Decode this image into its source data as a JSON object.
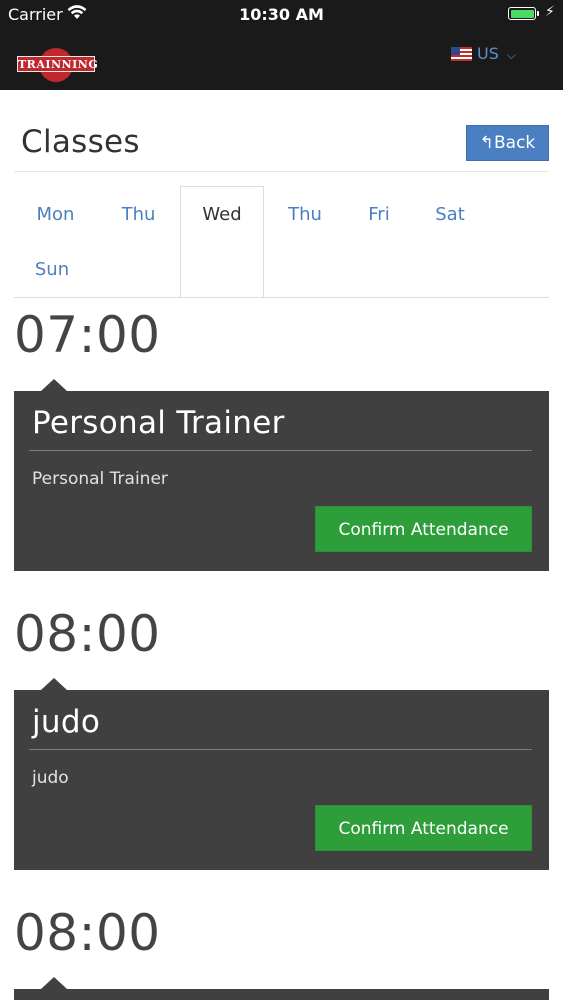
{
  "status_bar": {
    "carrier": "Carrier",
    "time": "10:30 AM",
    "battery_level": 1.0
  },
  "navbar": {
    "logo_text": "TRAINNING",
    "language": "US",
    "colors": {
      "background": "#1a1a1a",
      "accent": "#c0282d",
      "link": "#5a90d2"
    }
  },
  "header": {
    "title": "Classes",
    "back_label": "Back"
  },
  "tabs": [
    {
      "label": "Mon",
      "active": false
    },
    {
      "label": "Thu",
      "active": false
    },
    {
      "label": "Wed",
      "active": true
    },
    {
      "label": "Thu",
      "active": false
    },
    {
      "label": "Fri",
      "active": false
    },
    {
      "label": "Sat",
      "active": false
    },
    {
      "label": "Sun",
      "active": false
    }
  ],
  "classes": [
    {
      "time": "07:00",
      "title": "Personal Trainer",
      "description": "Personal Trainer",
      "button_label": "Confirm Attendance"
    },
    {
      "time": "08:00",
      "title": "judo",
      "description": "judo",
      "button_label": "Confirm Attendance"
    },
    {
      "time": "08:00",
      "title": "",
      "description": "",
      "button_label": ""
    }
  ],
  "colors": {
    "card": "#404041",
    "confirm": "#2e9e3a",
    "back_button": "#4a7fc1"
  }
}
